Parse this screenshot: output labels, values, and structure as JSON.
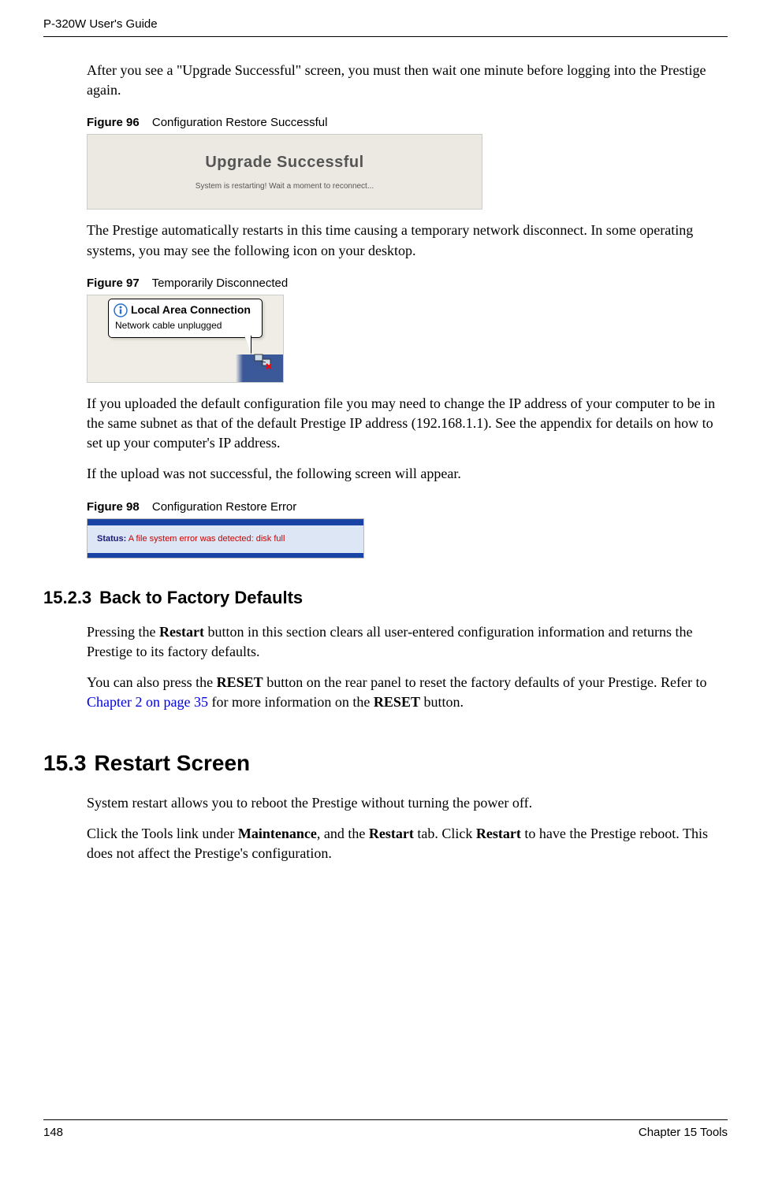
{
  "header": {
    "left": "P-320W User's Guide",
    "right": ""
  },
  "intro_para": "After you see a \"Upgrade Successful\" screen, you must then wait one minute before logging into the Prestige again.",
  "fig96": {
    "num": "Figure 96",
    "caption": "Configuration Restore Successful",
    "title": "Upgrade Successful",
    "subtitle": "System is restarting! Wait a moment to reconnect..."
  },
  "para_after96": "The Prestige automatically restarts in this time causing a temporary network disconnect. In some operating systems, you may see the following icon on your desktop.",
  "fig97": {
    "num": "Figure 97",
    "caption": "Temporarily Disconnected",
    "balloon_title": "Local Area Connection",
    "balloon_sub": "Network cable unplugged"
  },
  "para_after97": "If you uploaded the default configuration file you may need to change the IP address of your computer to be in the same subnet as that of the default Prestige IP address (192.168.1.1). See the appendix for details on how to set up your computer's IP address.",
  "para_upload_fail": "If the upload was not successful, the following screen will appear.",
  "fig98": {
    "num": "Figure 98",
    "caption": "Configuration Restore Error",
    "status_label": "Status:",
    "status_text": "A file system error was detected: disk full"
  },
  "sec1523": {
    "num": "15.2.3",
    "title": "Back to Factory Defaults",
    "para1_pre": "Pressing the ",
    "restart_bold": "Restart",
    "para1_post": " button in this section clears all user-entered configuration information and returns the Prestige to its factory defaults.",
    "para2_pre": "You can also press the ",
    "reset_bold": "RESET",
    "para2_mid": " button on the rear panel to reset the factory defaults of your Prestige. Refer to ",
    "link": "Chapter 2 on page 35",
    "para2_post": " for more information on the ",
    "reset_bold2": "RESET",
    "para2_end": " button."
  },
  "sec153": {
    "num": "15.3",
    "title": "Restart Screen",
    "para1": "System restart allows you to reboot the Prestige without turning the power off.",
    "para2_pre": "Click the Tools link under ",
    "maint_bold": "Maintenance",
    "para2_mid": ", and the ",
    "restart_bold": "Restart",
    "para2_mid2": " tab. Click ",
    "restart_bold2": "Restart",
    "para2_post": " to have the Prestige reboot. This does not affect the Prestige's configuration."
  },
  "footer": {
    "left": "148",
    "right": "Chapter 15 Tools"
  }
}
